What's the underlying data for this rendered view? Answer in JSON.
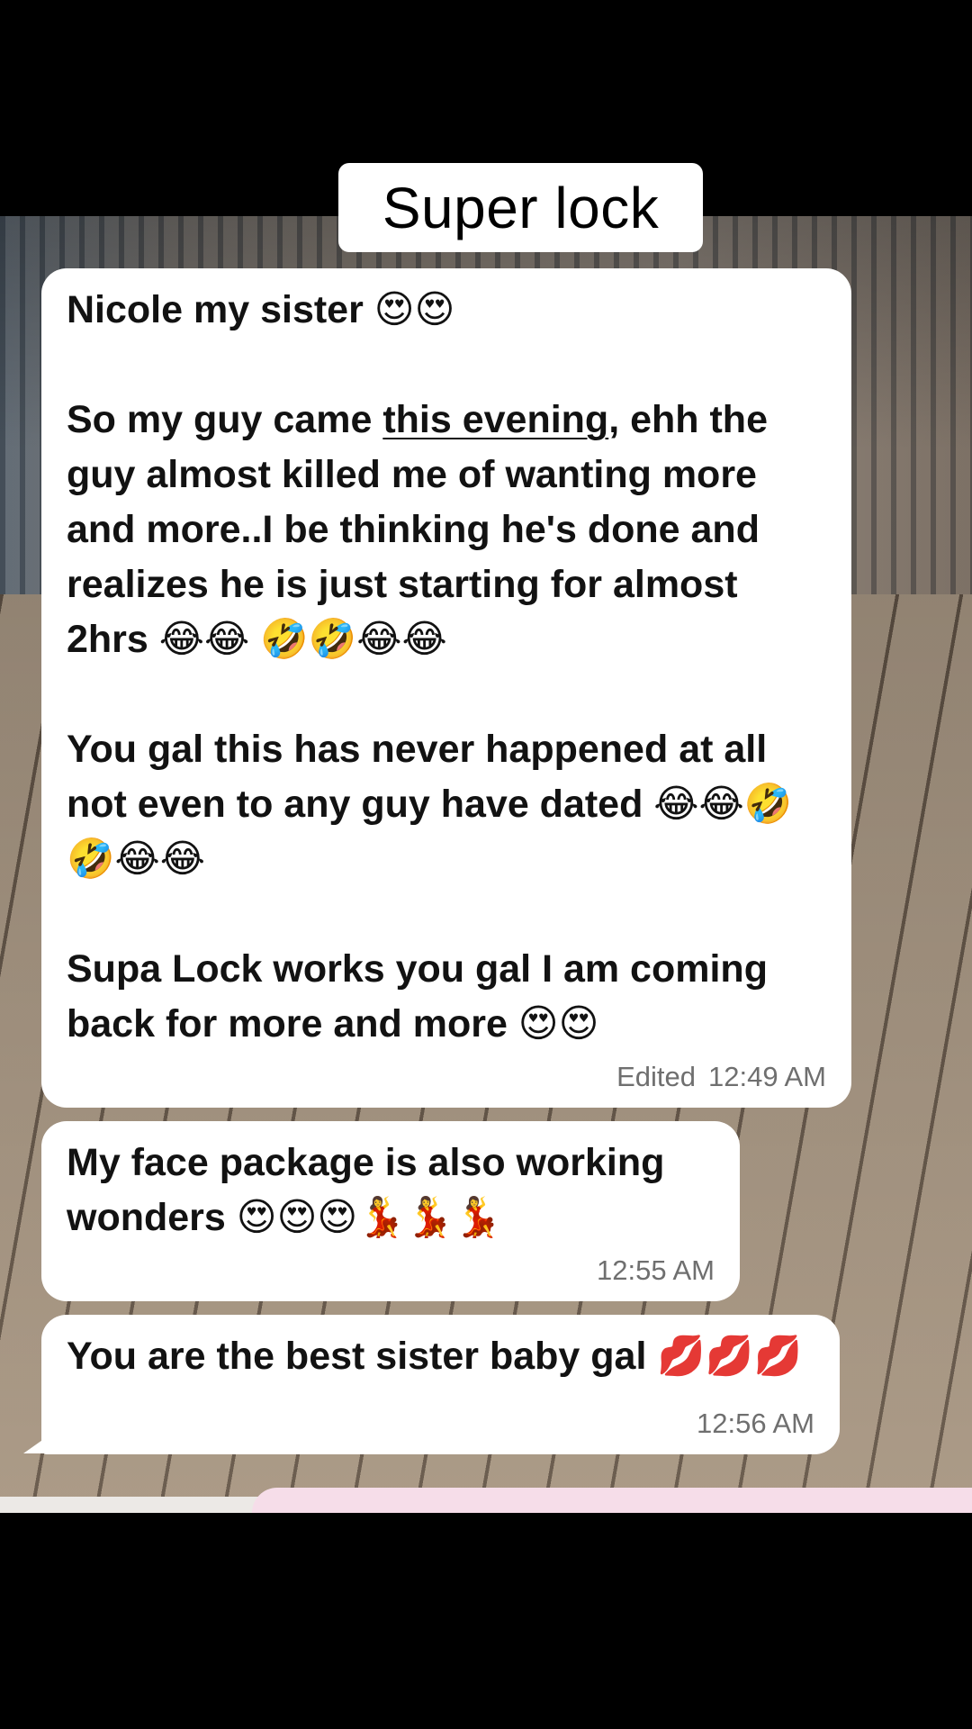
{
  "title": "Super lock",
  "messages": [
    {
      "paragraphs": [
        "Nicole my sister 😍😍",
        "",
        "So my guy came ",
        "this evening",
        ", ehh the guy almost killed me of wanting more and more..I be thinking he's done and realizes he is just starting for almost 2hrs 😂😂 🤣🤣😂😂",
        "",
        "You gal this has never happened at all not even to any guy have dated 😂😂🤣🤣😂😂",
        "",
        "Supa Lock works you gal I am coming back for more and more 😍😍"
      ],
      "edited_label": "Edited",
      "time": "12:49 AM"
    },
    {
      "text": "My face package is also working wonders 😍😍😍💃💃💃",
      "time": "12:55 AM"
    },
    {
      "text": "You are the best sister baby gal 💋💋💋",
      "time": "12:56 AM"
    }
  ]
}
